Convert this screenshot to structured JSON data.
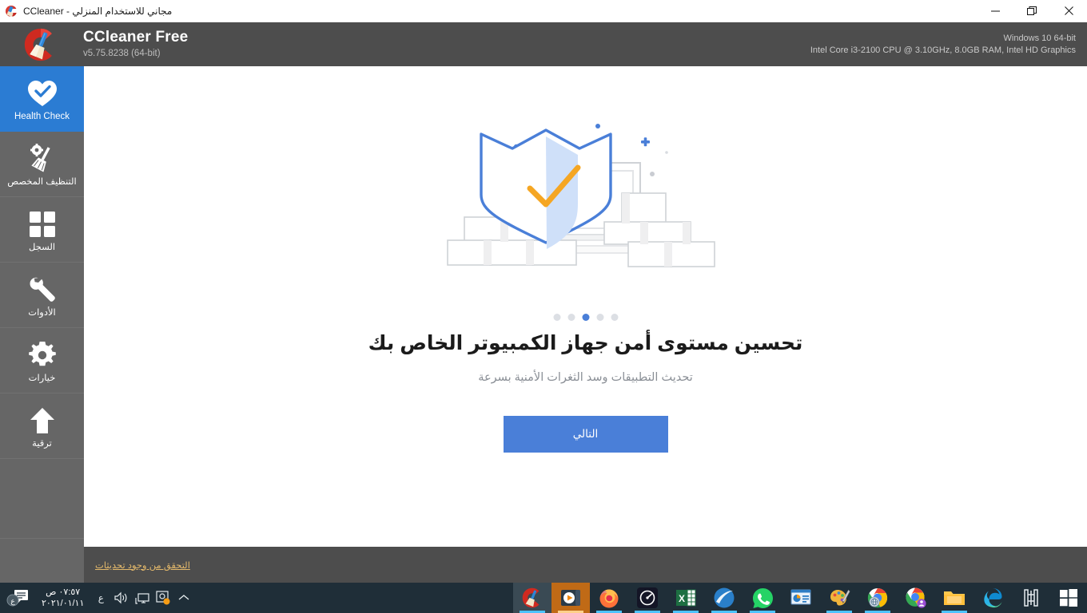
{
  "window": {
    "title": "CCleaner - مجاني للاستخدام المنزلي",
    "app_icon": "ccleaner-icon",
    "controls": {
      "minimize": "—",
      "restore": "❐",
      "close": "✕"
    }
  },
  "header": {
    "brand": "CCleaner Free",
    "version": "v5.75.8238 (64-bit)",
    "logo_icon": "ccleaner-logo",
    "os": "Windows 10 64-bit",
    "hardware": "Intel Core i3-2100 CPU @ 3.10GHz, 8.0GB RAM, Intel HD Graphics"
  },
  "sidebar": {
    "items": [
      {
        "label": "Health Check",
        "icon": "heart-check-icon",
        "active": true
      },
      {
        "label": "التنظيف المخصص",
        "icon": "broom-gear-icon",
        "active": false
      },
      {
        "label": "السجل",
        "icon": "registry-grid-icon",
        "active": false
      },
      {
        "label": "الأدوات",
        "icon": "wrench-icon",
        "active": false
      },
      {
        "label": "خيارات",
        "icon": "gear-icon",
        "active": false
      },
      {
        "label": "ترقية",
        "icon": "upgrade-arrow-icon",
        "active": false
      }
    ]
  },
  "main": {
    "illustration": "shield-check-laptop-bricks-illustration",
    "carousel": {
      "total": 5,
      "active_index": 3
    },
    "headline": "تحسين مستوى أمن جهاز الكمبيوتر الخاص بك",
    "subheadline": "تحديث التطبيقات وسد الثغرات الأمنية بسرعة",
    "cta_label": "التالي"
  },
  "footer": {
    "update_link": "التحقق من وجود تحديثات"
  },
  "taskbar": {
    "notification_icon": "notification-chat-icon",
    "clock_time": "٠٧:٥٧ ص",
    "clock_date": "٢٠٢١/٠١/١١",
    "language": "ع",
    "tray": [
      {
        "icon": "volume-icon"
      },
      {
        "icon": "network-display-icon"
      },
      {
        "icon": "app-tray-icon"
      },
      {
        "icon": "chevron-up-icon"
      }
    ],
    "apps": [
      {
        "icon": "ccleaner-taskbar-icon",
        "state": "active"
      },
      {
        "icon": "media-player-icon",
        "state": "active-orange"
      },
      {
        "icon": "firefox-icon",
        "state": "running"
      },
      {
        "icon": "speedtest-icon",
        "state": "running"
      },
      {
        "icon": "excel-icon",
        "state": "running"
      },
      {
        "icon": "blue-swoosh-app-icon",
        "state": "running"
      },
      {
        "icon": "whatsapp-icon",
        "state": "running"
      },
      {
        "icon": "powerpoint-icon",
        "state": "idle"
      },
      {
        "icon": "paint-icon",
        "state": "running"
      },
      {
        "icon": "chrome-globe-icon",
        "state": "running"
      },
      {
        "icon": "chrome-profile-icon",
        "state": "idle"
      },
      {
        "icon": "file-explorer-icon",
        "state": "running"
      },
      {
        "icon": "edge-icon",
        "state": "idle"
      },
      {
        "icon": "utility-app-icon",
        "state": "idle"
      }
    ],
    "start_icon": "windows-start-icon"
  },
  "colors": {
    "accent_blue": "#4a7fd8",
    "sidebar_active": "#2b7cd3",
    "header_gray": "#4d4d4d",
    "sidebar_gray": "#666666",
    "link_gold": "#e4b96b",
    "taskbar": "#1f2e38"
  }
}
